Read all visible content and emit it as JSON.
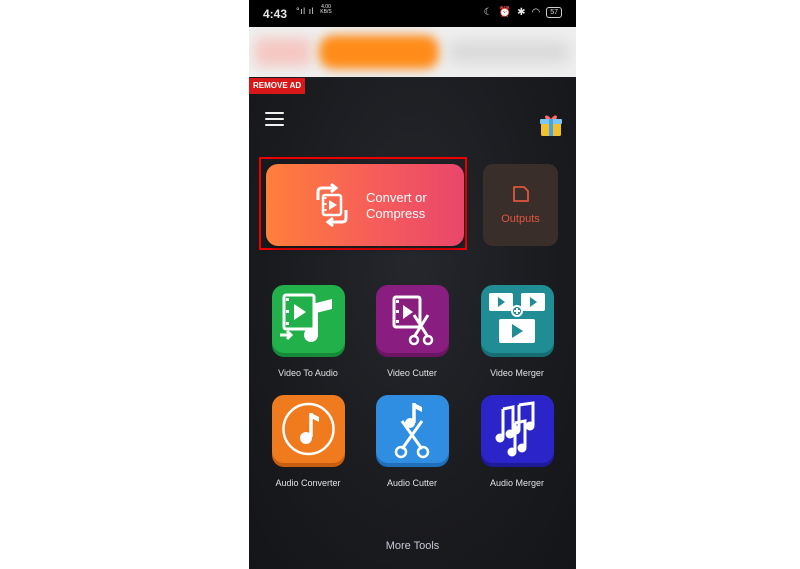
{
  "status_bar": {
    "time": "4:43",
    "signal": "°ıl ıl",
    "rate_value": "4.00",
    "rate_unit": "KB/S",
    "battery": "57"
  },
  "ad": {
    "remove_label": "REMOVE AD"
  },
  "main": {
    "convert_label": "Convert or Compress",
    "outputs_label": "Outputs"
  },
  "tools": [
    {
      "label": "Video To Audio",
      "color": "#21b04a"
    },
    {
      "label": "Video Cutter",
      "color": "#8a1d80"
    },
    {
      "label": "Video Merger",
      "color": "#1f8d93"
    },
    {
      "label": "Audio Converter",
      "color": "#f07a1e"
    },
    {
      "label": "Audio Cutter",
      "color": "#2f8de2"
    },
    {
      "label": "Audio Merger",
      "color": "#2b25c9"
    }
  ],
  "footer": {
    "more_tools": "More Tools"
  }
}
